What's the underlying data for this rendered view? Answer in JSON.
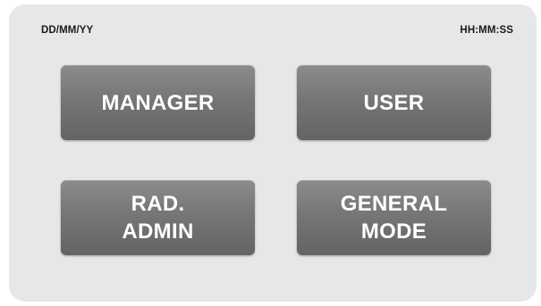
{
  "status_bar": {
    "date_placeholder": "DD/MM/YY",
    "time_placeholder": "HH:MM:SS"
  },
  "menu": {
    "buttons": [
      {
        "label": "MANAGER"
      },
      {
        "label": "USER"
      },
      {
        "label": "RAD.\nADMIN"
      },
      {
        "label": "GENERAL\nMODE"
      }
    ]
  },
  "colors": {
    "screen_background": "#e6e7e8",
    "button_top": "#8a8c8e",
    "button_bottom": "#626466",
    "button_text": "#ffffff",
    "status_text": "#1a1a1a"
  }
}
